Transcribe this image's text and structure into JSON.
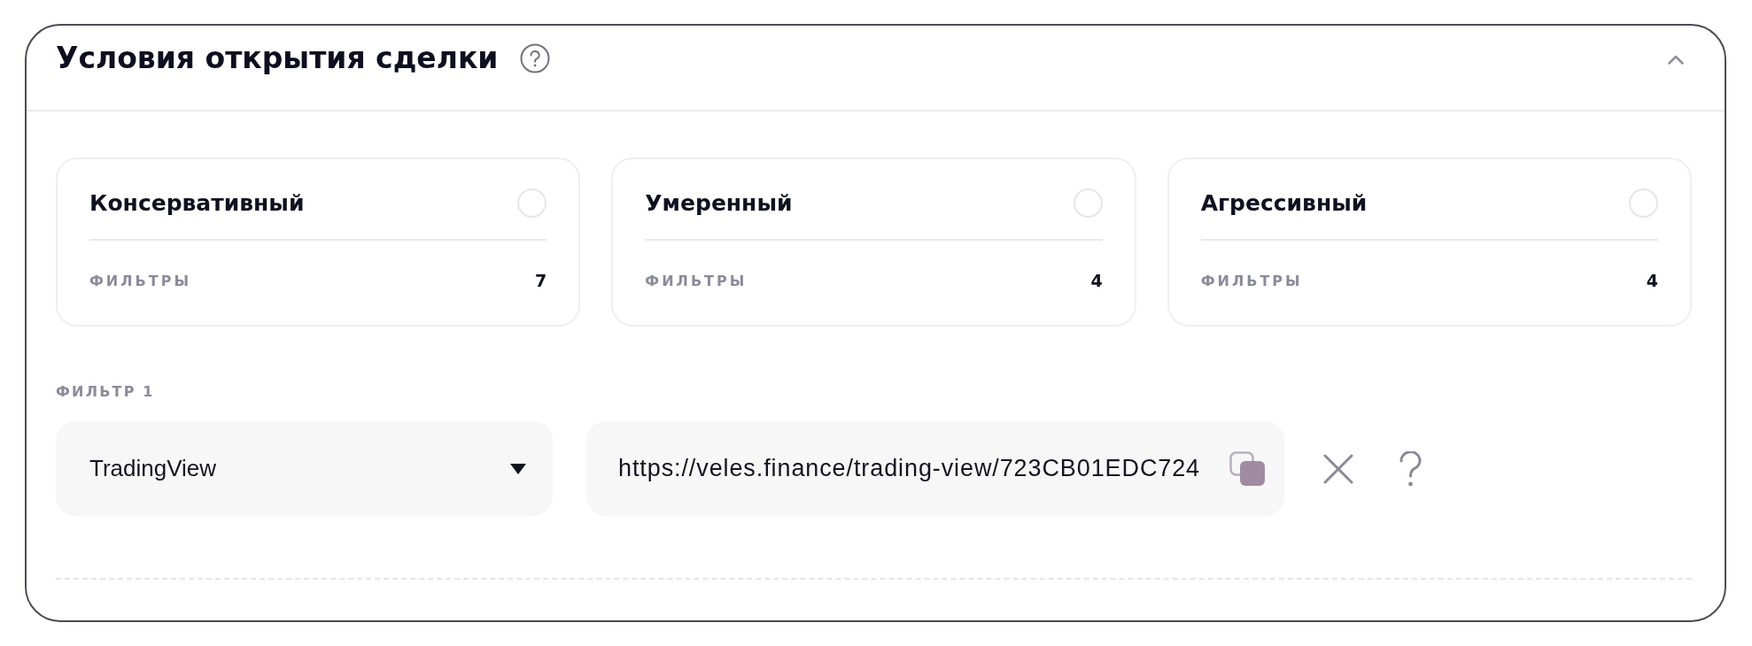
{
  "section": {
    "title": "Условия открытия сделки",
    "expanded": true
  },
  "strategies": [
    {
      "name": "Консервативный",
      "selected": false,
      "filters_label": "ФИЛЬТРЫ",
      "filters_count": "7"
    },
    {
      "name": "Умеренный",
      "selected": false,
      "filters_label": "ФИЛЬТРЫ",
      "filters_count": "4"
    },
    {
      "name": "Агрессивный",
      "selected": false,
      "filters_label": "ФИЛЬТРЫ",
      "filters_count": "4"
    }
  ],
  "filters": [
    {
      "label": "ФИЛЬТР 1",
      "source": "TradingView",
      "url": "https://veles.finance/trading-view/723CB01EDC724"
    }
  ]
}
